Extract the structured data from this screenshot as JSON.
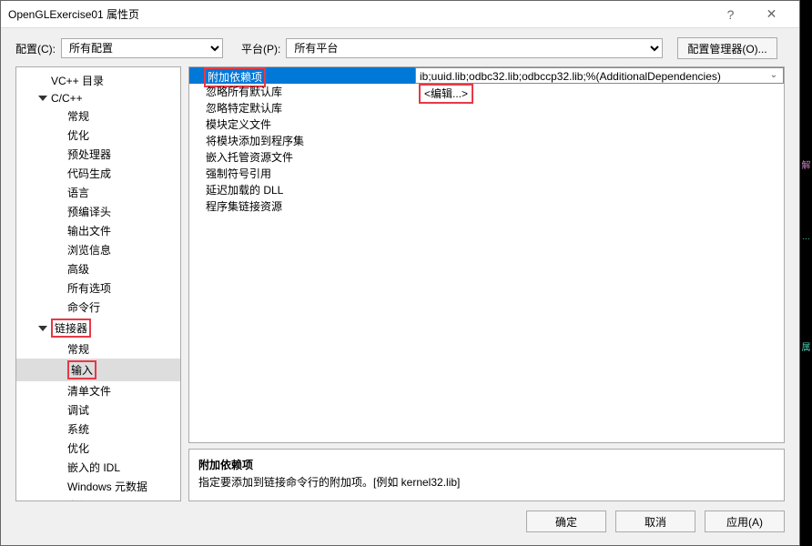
{
  "title": "OpenGLExercise01 属性页",
  "config_label": "配置(C):",
  "config_value": "所有配置",
  "platform_label": "平台(P):",
  "platform_value": "所有平台",
  "config_manager_btn": "配置管理器(O)...",
  "tree": {
    "vcpp_dir": "VC++ 目录",
    "ccpp": "C/C++",
    "ccpp_items": [
      "常规",
      "优化",
      "预处理器",
      "代码生成",
      "语言",
      "预编译头",
      "输出文件",
      "浏览信息",
      "高级",
      "所有选项",
      "命令行"
    ],
    "linker": "链接器",
    "linker_items": [
      "常规",
      "输入",
      "清单文件",
      "调试",
      "系统",
      "优化",
      "嵌入的 IDL",
      "Windows 元数据",
      "高级"
    ]
  },
  "grid": {
    "additional_deps": "附加依赖项",
    "additional_deps_value": "ib;uuid.lib;odbc32.lib;odbccp32.lib;%(AdditionalDependencies)",
    "ignore_all_default": "忽略所有默认库",
    "ignore_all_default_value": "<编辑...>",
    "ignore_specific": "忽略特定默认库",
    "module_def": "模块定义文件",
    "add_module_assembly": "将模块添加到程序集",
    "embed_managed_res": "嵌入托管资源文件",
    "force_symbol": "强制符号引用",
    "delay_loaded_dll": "延迟加载的 DLL",
    "assembly_link_res": "程序集链接资源"
  },
  "desc": {
    "title": "附加依赖项",
    "text": "指定要添加到链接命令行的附加项。[例如 kernel32.lib]"
  },
  "buttons": {
    "ok": "确定",
    "cancel": "取消",
    "apply": "应用(A)"
  }
}
